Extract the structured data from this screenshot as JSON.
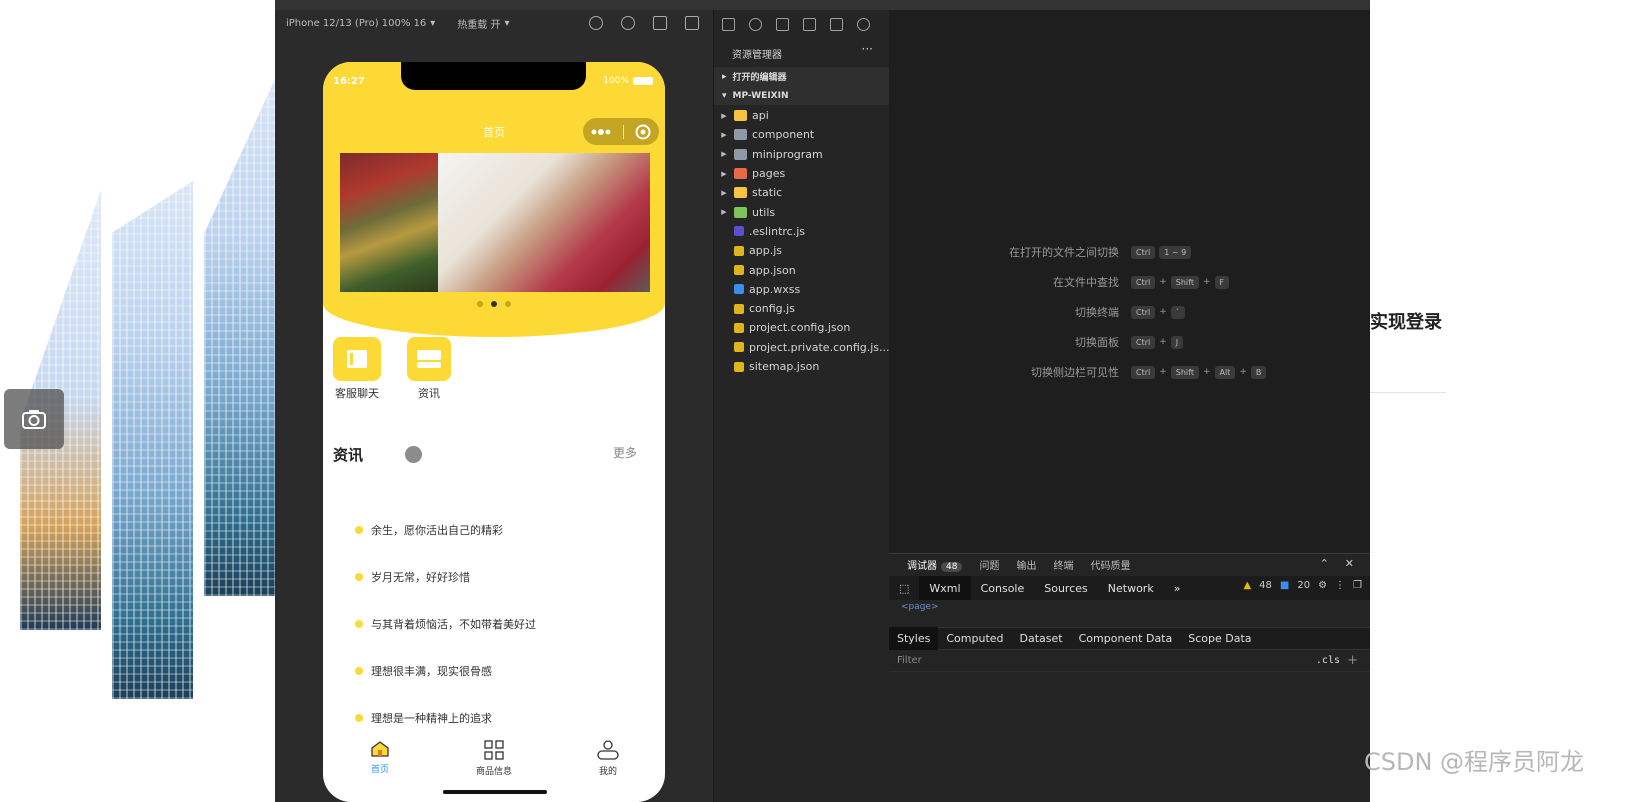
{
  "simulator": {
    "device": "iPhone 12/13 (Pro) 100% 16",
    "hot_reload": "热重载 开",
    "status_time": "16:27",
    "battery": "100%",
    "nav_title": "首页",
    "quick_links": [
      "客服聊天",
      "资讯"
    ],
    "section_title": "资讯",
    "section_more": "更多",
    "news": [
      "余生，愿你活出自己的精彩",
      "岁月无常，好好珍惜",
      "与其背着烦恼活，不如带着美好过",
      "理想很丰满，现实很骨感",
      "理想是一种精神上的追求"
    ],
    "tabs": [
      "首页",
      "商品信息",
      "我的"
    ],
    "banner_active_index": 1,
    "accent": "#fdd935",
    "tab_active_color": "#1e9cf0"
  },
  "explorer": {
    "title": "资源管理器",
    "more": "···",
    "open_editors": "打开的编辑器",
    "project": "MP-WEIXIN",
    "items": [
      {
        "name": "api",
        "type": "folder",
        "color": "#f5c542"
      },
      {
        "name": "component",
        "type": "folder",
        "color": "#8f9aa6"
      },
      {
        "name": "miniprogram",
        "type": "folder",
        "color": "#8f9aa6"
      },
      {
        "name": "pages",
        "type": "folder",
        "color": "#e8684a"
      },
      {
        "name": "static",
        "type": "folder",
        "color": "#f5c542"
      },
      {
        "name": "utils",
        "type": "folder",
        "color": "#7cc45b"
      },
      {
        "name": ".eslintrc.js",
        "type": "file",
        "color": "#5b4fcf"
      },
      {
        "name": "app.js",
        "type": "file",
        "color": "#e0b51b"
      },
      {
        "name": "app.json",
        "type": "file",
        "color": "#e0b51b"
      },
      {
        "name": "app.wxss",
        "type": "file",
        "color": "#3a8eea"
      },
      {
        "name": "config.js",
        "type": "file",
        "color": "#e0b51b"
      },
      {
        "name": "project.config.json",
        "type": "file",
        "color": "#e0b51b"
      },
      {
        "name": "project.private.config.js...",
        "type": "file",
        "color": "#e0b51b"
      },
      {
        "name": "sitemap.json",
        "type": "file",
        "color": "#e0b51b"
      }
    ]
  },
  "shortcuts": [
    {
      "label": "在打开的文件之间切换",
      "keys": [
        "Ctrl",
        "1 ~ 9"
      ],
      "joiner": ""
    },
    {
      "label": "在文件中查找",
      "keys": [
        "Ctrl",
        "Shift",
        "F"
      ],
      "joiner": "+"
    },
    {
      "label": "切换终端",
      "keys": [
        "Ctrl",
        "`"
      ],
      "joiner": "+"
    },
    {
      "label": "切换面板",
      "keys": [
        "Ctrl",
        "J"
      ],
      "joiner": "+"
    },
    {
      "label": "切换侧边栏可见性",
      "keys": [
        "Ctrl",
        "Shift",
        "Alt",
        "B"
      ],
      "joiner": "+"
    }
  ],
  "debugger": {
    "tabs": [
      "调试器",
      "问题",
      "输出",
      "终端",
      "代码质量"
    ],
    "badge": "48",
    "devtools_tabs": [
      "Wxml",
      "Console",
      "Sources",
      "Network"
    ],
    "overflow": "»",
    "warnings": "48",
    "errors": "20",
    "dom_line": "<page>",
    "style_tabs": [
      "Styles",
      "Computed",
      "Dataset",
      "Component Data",
      "Scope Data"
    ],
    "filter_placeholder": "Filter",
    "cls": ".cls",
    "plus": "+"
  },
  "right_panel": {
    "title": "实现登录",
    "watermark": "CSDN @程序员阿龙"
  }
}
